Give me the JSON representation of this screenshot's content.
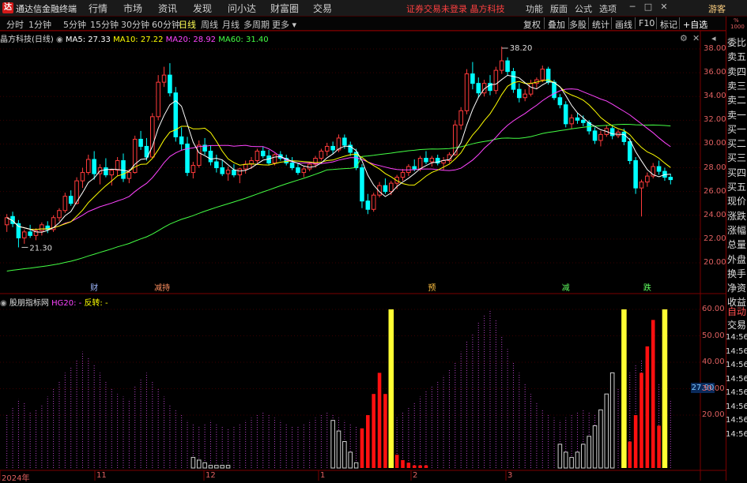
{
  "titlebar": {
    "app_name": "通达信金融终端",
    "menus": [
      "行情",
      "市场",
      "资讯",
      "发现",
      "问小达",
      "财富圈",
      "交易"
    ],
    "login_status": "证券交易未登录",
    "broker": "晶方科技",
    "right_menus": [
      "功能",
      "版面",
      "公式",
      "选项"
    ],
    "guest": "游客",
    "window_buttons": [
      "─",
      "□",
      "✕"
    ]
  },
  "tabbar": {
    "periods": [
      "分时",
      "1分钟",
      "5分钟",
      "15分钟",
      "30分钟",
      "60分钟",
      "日线",
      "周线",
      "月线",
      "多周期",
      "更多"
    ],
    "active": "日线",
    "tools": [
      "复权",
      "叠加",
      "多股",
      "统计",
      "画线",
      "F10",
      "标记",
      "+自选"
    ]
  },
  "kline_info": {
    "stock": "晶方科技(日线)",
    "ma5_label": "MA5: 27.33",
    "ma10_label": "MA10: 27.22",
    "ma20_label": "MA20: 28.92",
    "ma60_label": "MA60: 31.40",
    "colors": {
      "ma5": "#ffffff",
      "ma10": "#ffff00",
      "ma20": "#ff44ff",
      "ma60": "#44ff44"
    }
  },
  "indicator_info": {
    "name": "股朋指标网",
    "hg_label": "HG20: -",
    "fz_label": "反转: -"
  },
  "right_panel": {
    "labels": [
      "委比",
      "卖五",
      "卖四",
      "卖三",
      "卖二",
      "卖一",
      "买一",
      "买二",
      "买三",
      "买四",
      "买五",
      "现价",
      "涨跌",
      "涨幅",
      "总量",
      "外盘",
      "换手",
      "净资",
      "收益"
    ],
    "lower_labels": [
      "自动",
      "交易"
    ],
    "times": [
      "14:56",
      "14:56",
      "14:56",
      "14:56",
      "14:56",
      "14:56",
      "14:56",
      "14:56"
    ],
    "top_small": [
      "%",
      "1000"
    ]
  },
  "price_axis": [
    "38.00",
    "36.00",
    "34.00",
    "32.00",
    "30.00",
    "28.00",
    "26.00",
    "24.00",
    "22.00",
    "20.00"
  ],
  "ind_axis": [
    "60.00",
    "50.00",
    "40.00",
    "30.00",
    "20.00"
  ],
  "current_value": "27.90",
  "x_axis": [
    "2024年",
    "11",
    "12",
    "1",
    "2",
    "3"
  ],
  "annotations": {
    "high": "38.20",
    "low": "21.30",
    "events": [
      "财",
      "减持",
      "预",
      "减",
      "跌"
    ]
  },
  "chart_data": [
    {
      "type": "candlestick",
      "title": "晶方科技(日线)",
      "ylim": [
        20,
        38.5
      ],
      "x_labels": [
        "2024年",
        "11",
        "12",
        "1",
        "2",
        "3"
      ],
      "ohlc": [
        [
          23.2,
          24.1,
          22.6,
          23.8
        ],
        [
          23.9,
          24.3,
          23.0,
          23.3
        ],
        [
          23.3,
          23.6,
          21.3,
          22.1
        ],
        [
          22.1,
          22.8,
          21.6,
          22.6
        ],
        [
          22.6,
          23.2,
          22.1,
          22.3
        ],
        [
          22.3,
          22.9,
          21.9,
          22.7
        ],
        [
          22.7,
          23.4,
          22.3,
          23.2
        ],
        [
          23.1,
          23.5,
          22.5,
          22.8
        ],
        [
          22.8,
          24.0,
          22.6,
          23.8
        ],
        [
          23.8,
          24.6,
          23.5,
          24.4
        ],
        [
          24.4,
          25.9,
          24.2,
          25.6
        ],
        [
          25.6,
          26.1,
          24.8,
          25.0
        ],
        [
          25.0,
          27.2,
          24.9,
          26.9
        ],
        [
          26.9,
          28.0,
          26.3,
          27.6
        ],
        [
          27.6,
          29.1,
          27.4,
          28.7
        ],
        [
          28.7,
          29.4,
          27.0,
          27.5
        ],
        [
          27.5,
          28.3,
          26.6,
          28.0
        ],
        [
          28.0,
          28.8,
          27.2,
          27.4
        ],
        [
          27.4,
          27.9,
          26.5,
          27.8
        ],
        [
          27.8,
          28.9,
          27.3,
          28.6
        ],
        [
          28.6,
          29.2,
          26.8,
          27.1
        ],
        [
          27.1,
          27.9,
          26.7,
          27.6
        ],
        [
          27.6,
          30.7,
          27.5,
          30.4
        ],
        [
          30.4,
          31.1,
          29.5,
          29.8
        ],
        [
          29.8,
          30.5,
          28.6,
          28.9
        ],
        [
          28.9,
          32.6,
          28.8,
          32.3
        ],
        [
          32.3,
          35.8,
          32.0,
          35.2
        ],
        [
          35.2,
          36.5,
          34.8,
          35.8
        ],
        [
          35.8,
          36.8,
          34.0,
          34.3
        ],
        [
          34.3,
          34.8,
          30.2,
          30.6
        ],
        [
          30.6,
          31.4,
          29.5,
          30.0
        ],
        [
          30.0,
          30.6,
          27.3,
          27.6
        ],
        [
          27.6,
          28.5,
          27.1,
          28.2
        ],
        [
          28.2,
          30.3,
          28.0,
          29.9
        ],
        [
          29.9,
          30.5,
          29.1,
          29.4
        ],
        [
          29.4,
          29.9,
          28.2,
          28.5
        ],
        [
          28.5,
          29.1,
          27.6,
          28.0
        ],
        [
          28.0,
          28.6,
          27.3,
          27.5
        ],
        [
          27.5,
          28.1,
          26.9,
          27.8
        ],
        [
          27.8,
          28.3,
          27.2,
          27.4
        ],
        [
          27.4,
          28.0,
          26.7,
          27.9
        ],
        [
          27.9,
          28.6,
          27.5,
          28.3
        ],
        [
          28.3,
          28.9,
          27.9,
          28.6
        ],
        [
          28.6,
          29.6,
          28.4,
          29.4
        ],
        [
          29.4,
          29.8,
          28.8,
          29.0
        ],
        [
          29.0,
          29.5,
          28.2,
          28.4
        ],
        [
          28.4,
          29.2,
          28.2,
          29.1
        ],
        [
          29.1,
          29.4,
          28.6,
          28.8
        ],
        [
          28.8,
          29.1,
          28.2,
          28.4
        ],
        [
          28.4,
          28.9,
          27.8,
          28.0
        ],
        [
          28.0,
          28.4,
          27.4,
          27.6
        ],
        [
          27.6,
          28.1,
          27.2,
          27.9
        ],
        [
          27.9,
          28.5,
          27.7,
          28.3
        ],
        [
          28.3,
          29.0,
          28.0,
          28.8
        ],
        [
          28.8,
          29.6,
          28.6,
          29.4
        ],
        [
          29.4,
          30.1,
          29.0,
          29.8
        ],
        [
          29.8,
          30.2,
          29.2,
          29.5
        ],
        [
          29.5,
          30.8,
          29.3,
          30.5
        ],
        [
          30.5,
          30.8,
          29.6,
          29.9
        ],
        [
          29.9,
          30.2,
          29.0,
          29.3
        ],
        [
          29.3,
          29.6,
          27.8,
          28.0
        ],
        [
          28.0,
          28.3,
          24.6,
          25.2
        ],
        [
          25.2,
          25.8,
          24.1,
          24.5
        ],
        [
          24.5,
          25.9,
          24.3,
          25.7
        ],
        [
          25.7,
          26.8,
          25.5,
          26.5
        ],
        [
          26.5,
          27.1,
          25.8,
          26.0
        ],
        [
          26.0,
          26.9,
          25.7,
          26.7
        ],
        [
          26.7,
          27.4,
          26.2,
          27.2
        ],
        [
          27.2,
          27.9,
          26.9,
          27.6
        ],
        [
          27.6,
          28.3,
          27.3,
          28.1
        ],
        [
          28.1,
          28.7,
          27.7,
          27.9
        ],
        [
          27.9,
          29.0,
          27.7,
          28.8
        ],
        [
          28.8,
          29.4,
          28.3,
          28.5
        ],
        [
          28.5,
          29.0,
          28.1,
          28.8
        ],
        [
          28.8,
          29.1,
          28.2,
          28.4
        ],
        [
          28.4,
          28.9,
          27.8,
          28.6
        ],
        [
          28.6,
          29.3,
          28.4,
          29.1
        ],
        [
          29.1,
          32.0,
          29.0,
          31.6
        ],
        [
          31.6,
          33.1,
          31.2,
          32.8
        ],
        [
          32.8,
          36.3,
          32.5,
          35.9
        ],
        [
          35.9,
          36.9,
          34.6,
          35.1
        ],
        [
          35.1,
          35.6,
          33.9,
          34.3
        ],
        [
          34.3,
          35.4,
          34.0,
          35.1
        ],
        [
          35.1,
          35.8,
          34.1,
          34.5
        ],
        [
          34.5,
          36.5,
          34.2,
          36.2
        ],
        [
          36.2,
          38.2,
          35.9,
          37.0
        ],
        [
          37.0,
          37.3,
          35.8,
          36.1
        ],
        [
          36.1,
          36.4,
          34.3,
          34.6
        ],
        [
          34.6,
          35.1,
          33.5,
          33.9
        ],
        [
          33.9,
          34.6,
          33.6,
          34.2
        ],
        [
          34.2,
          35.4,
          34.0,
          35.1
        ],
        [
          35.1,
          35.6,
          34.6,
          35.4
        ],
        [
          35.4,
          36.6,
          35.2,
          36.3
        ],
        [
          36.3,
          36.5,
          35.0,
          35.2
        ],
        [
          35.2,
          35.4,
          33.7,
          33.9
        ],
        [
          33.9,
          34.2,
          33.0,
          33.3
        ],
        [
          33.3,
          33.6,
          31.4,
          31.7
        ],
        [
          31.7,
          32.5,
          31.3,
          32.2
        ],
        [
          32.2,
          32.6,
          31.7,
          32.0
        ],
        [
          32.0,
          32.4,
          31.5,
          31.8
        ],
        [
          31.8,
          32.0,
          30.8,
          31.1
        ],
        [
          31.1,
          31.4,
          30.0,
          30.3
        ],
        [
          30.3,
          31.1,
          29.8,
          30.8
        ],
        [
          30.8,
          31.6,
          30.6,
          31.3
        ],
        [
          31.3,
          31.5,
          30.4,
          30.7
        ],
        [
          30.7,
          31.2,
          30.5,
          31.0
        ],
        [
          31.0,
          31.3,
          29.9,
          30.2
        ],
        [
          30.2,
          30.5,
          28.3,
          28.6
        ],
        [
          28.6,
          28.9,
          25.8,
          26.3
        ],
        [
          26.3,
          27.0,
          23.9,
          26.8
        ],
        [
          26.8,
          27.6,
          26.4,
          27.3
        ],
        [
          27.3,
          28.4,
          27.1,
          28.1
        ],
        [
          28.1,
          28.6,
          27.4,
          27.7
        ],
        [
          27.7,
          28.0,
          26.9,
          27.2
        ],
        [
          27.2,
          27.5,
          26.6,
          27.0
        ]
      ],
      "ma_lines": [
        "MA5",
        "MA10",
        "MA20",
        "MA60"
      ]
    },
    {
      "type": "bar",
      "title": "股朋指标网",
      "ylim": [
        0,
        62
      ],
      "series": [
        {
          "name": "HG20",
          "values": [
            20,
            23,
            26,
            25,
            21,
            22,
            24,
            27,
            30,
            33,
            36,
            38,
            41,
            44,
            42,
            39,
            36,
            33,
            30,
            28,
            27,
            26,
            31,
            34,
            36,
            33,
            30,
            27,
            24,
            22,
            20,
            18,
            17,
            16,
            17,
            18,
            17,
            16,
            15,
            16,
            17,
            18,
            19,
            20,
            21,
            20,
            19,
            18,
            17,
            16,
            16,
            17,
            18,
            19,
            20,
            21,
            20,
            19,
            18,
            17,
            16,
            15,
            14,
            15,
            16,
            17,
            18,
            19,
            21,
            23,
            25,
            27,
            29,
            31,
            33,
            35,
            37,
            40,
            44,
            48,
            51,
            55,
            58,
            60,
            56,
            50,
            45,
            40,
            36,
            32,
            28,
            25,
            22,
            20,
            19,
            18,
            19,
            20,
            21,
            22,
            21,
            20,
            22,
            24,
            27,
            30,
            33,
            36,
            39,
            41,
            38,
            35,
            32,
            29,
            26
          ]
        },
        {
          "name": "白柱",
          "values": [
            0,
            0,
            0,
            0,
            0,
            0,
            0,
            0,
            0,
            0,
            0,
            0,
            0,
            0,
            0,
            0,
            0,
            0,
            0,
            0,
            0,
            0,
            0,
            0,
            0,
            0,
            0,
            0,
            0,
            0,
            0,
            0,
            4,
            3,
            2,
            1,
            1,
            1,
            1,
            0,
            0,
            0,
            0,
            0,
            0,
            0,
            0,
            0,
            0,
            0,
            0,
            0,
            0,
            0,
            0,
            0,
            18,
            14,
            10,
            6,
            2,
            0,
            0,
            0,
            0,
            0,
            0,
            0,
            0,
            0,
            0,
            0,
            0,
            0,
            0,
            0,
            0,
            0,
            0,
            0,
            0,
            0,
            0,
            0,
            0,
            0,
            0,
            0,
            0,
            0,
            0,
            0,
            0,
            0,
            0,
            9,
            6,
            4,
            6,
            9,
            12,
            16,
            22,
            28,
            36,
            0,
            0,
            0,
            0,
            0,
            0,
            0,
            0,
            0,
            0
          ]
        },
        {
          "name": "红柱",
          "values": [
            0,
            0,
            0,
            0,
            0,
            0,
            0,
            0,
            0,
            0,
            0,
            0,
            0,
            0,
            0,
            0,
            0,
            0,
            0,
            0,
            0,
            0,
            0,
            0,
            0,
            0,
            0,
            0,
            0,
            0,
            0,
            0,
            0,
            0,
            0,
            0,
            0,
            0,
            0,
            0,
            0,
            0,
            0,
            0,
            0,
            0,
            0,
            0,
            0,
            0,
            0,
            0,
            0,
            0,
            0,
            0,
            0,
            0,
            0,
            0,
            0,
            15,
            20,
            28,
            36,
            28,
            18,
            5,
            3,
            2,
            1,
            1,
            1,
            0,
            0,
            0,
            0,
            0,
            0,
            0,
            0,
            0,
            0,
            0,
            0,
            0,
            0,
            0,
            0,
            0,
            0,
            0,
            0,
            0,
            0,
            0,
            0,
            0,
            0,
            0,
            0,
            0,
            0,
            0,
            0,
            0,
            4,
            10,
            20,
            36,
            46,
            56,
            16,
            0,
            0
          ]
        },
        {
          "name": "黄柱",
          "values": [
            0,
            0,
            0,
            0,
            0,
            0,
            0,
            0,
            0,
            0,
            0,
            0,
            0,
            0,
            0,
            0,
            0,
            0,
            0,
            0,
            0,
            0,
            0,
            0,
            0,
            0,
            0,
            0,
            0,
            0,
            0,
            0,
            0,
            0,
            0,
            0,
            0,
            0,
            0,
            0,
            0,
            0,
            0,
            0,
            0,
            0,
            0,
            0,
            0,
            0,
            0,
            0,
            0,
            0,
            0,
            0,
            0,
            0,
            0,
            0,
            0,
            0,
            0,
            0,
            0,
            0,
            60,
            0,
            0,
            0,
            0,
            0,
            0,
            0,
            0,
            0,
            0,
            0,
            0,
            0,
            0,
            0,
            0,
            0,
            0,
            0,
            0,
            0,
            0,
            0,
            0,
            0,
            0,
            0,
            0,
            0,
            0,
            0,
            0,
            0,
            0,
            0,
            0,
            0,
            0,
            0,
            60,
            0,
            0,
            0,
            0,
            0,
            0,
            60,
            0
          ]
        }
      ]
    }
  ]
}
